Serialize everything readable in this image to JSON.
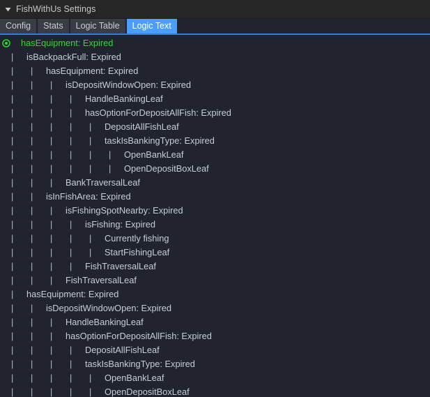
{
  "window": {
    "title": "FishWithUs Settings",
    "foldout_icon": "triangle-down-icon",
    "expanded": true
  },
  "colors": {
    "titlebar_bg": "#262626",
    "body_bg": "#21232e",
    "tab_bg": "#393c44",
    "tab_active_bg": "#4a9eff",
    "tab_text": "#c9cdd2",
    "tab_active_text": "#ffffff",
    "underline": "#2b7fe0",
    "row_text": "#c8cdd4",
    "root_text": "#2ddd2d",
    "guide_text": "#b4b9c0"
  },
  "tabs": [
    {
      "label": "Config",
      "active": false
    },
    {
      "label": "Stats",
      "active": false
    },
    {
      "label": "Logic Table",
      "active": false
    },
    {
      "label": "Logic Text",
      "active": true
    }
  ],
  "tree": {
    "rows": [
      {
        "depth": 0,
        "label": "hasEquipment: Expired",
        "root": true,
        "icon": "record-circle-icon"
      },
      {
        "depth": 1,
        "label": "isBackpackFull: Expired"
      },
      {
        "depth": 2,
        "label": "hasEquipment: Expired"
      },
      {
        "depth": 3,
        "label": "isDepositWindowOpen: Expired"
      },
      {
        "depth": 4,
        "label": "HandleBankingLeaf"
      },
      {
        "depth": 4,
        "label": "hasOptionForDepositAllFish: Expired"
      },
      {
        "depth": 5,
        "label": "DepositAllFishLeaf"
      },
      {
        "depth": 5,
        "label": "taskIsBankingType: Expired"
      },
      {
        "depth": 6,
        "label": "OpenBankLeaf"
      },
      {
        "depth": 6,
        "label": "OpenDepositBoxLeaf"
      },
      {
        "depth": 3,
        "label": "BankTraversalLeaf"
      },
      {
        "depth": 2,
        "label": "isInFishArea: Expired"
      },
      {
        "depth": 3,
        "label": "isFishingSpotNearby: Expired"
      },
      {
        "depth": 4,
        "label": "isFishing: Expired"
      },
      {
        "depth": 5,
        "label": "Currently fishing"
      },
      {
        "depth": 5,
        "label": "StartFishingLeaf"
      },
      {
        "depth": 4,
        "label": "FishTraversalLeaf"
      },
      {
        "depth": 3,
        "label": "FishTraversalLeaf"
      },
      {
        "depth": 1,
        "label": "hasEquipment: Expired"
      },
      {
        "depth": 2,
        "label": "isDepositWindowOpen: Expired"
      },
      {
        "depth": 3,
        "label": "HandleBankingLeaf"
      },
      {
        "depth": 3,
        "label": "hasOptionForDepositAllFish: Expired"
      },
      {
        "depth": 4,
        "label": "DepositAllFishLeaf"
      },
      {
        "depth": 4,
        "label": "taskIsBankingType: Expired"
      },
      {
        "depth": 5,
        "label": "OpenBankLeaf"
      },
      {
        "depth": 5,
        "label": "OpenDepositBoxLeaf"
      }
    ],
    "guide_char": "|"
  }
}
